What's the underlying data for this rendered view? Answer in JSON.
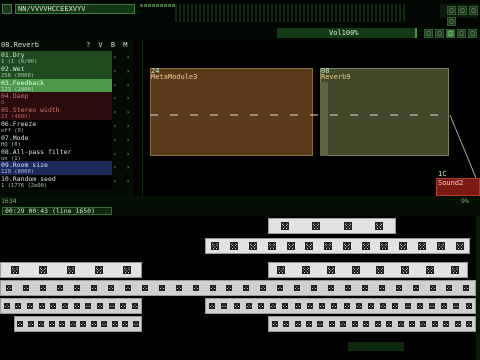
{
  "toolbar": {
    "song_name": "NN/VVVVHCCEEXVYV",
    "volume": "Vol100%",
    "buttons": [
      "◆",
      "□",
      "◉",
      "▸",
      "■"
    ],
    "right_buttons_top": [
      "□",
      "□",
      "□",
      "□"
    ],
    "right_buttons_mid": [
      "□",
      "□",
      "□",
      "□",
      "□"
    ]
  },
  "module_panel": {
    "title": "08.Reverb",
    "flags": "? V B M S",
    "controls": [
      {
        "label": "01.Dry",
        "value": "1 (1 (6/00)",
        "row_color": "#d4e8d4",
        "sub_color": "#a8c8a8",
        "bg": "#1f4a1f"
      },
      {
        "label": "02.Wet",
        "value": "256 (0000)",
        "row_color": "#d4e8d4",
        "sub_color": "#a8c8a8",
        "bg": "#1f4a1f"
      },
      {
        "label": "03.Feedback",
        "value": "123 (2000)",
        "row_color": "#f0f0f0",
        "sub_color": "#c8dac8",
        "bg": "#4a9a4a"
      },
      {
        "label": "04.Damp",
        "value": "0",
        "row_color": "#d47070",
        "sub_color": "#a86060",
        "bg": "#2a0c0c"
      },
      {
        "label": "05.Stereo width",
        "value": "23 (4000)",
        "row_color": "#e07070",
        "sub_color": "#b06060",
        "bg": "#2a0c0c"
      },
      {
        "label": "06.Freeze",
        "value": "off (0)",
        "row_color": "#d4e8d4",
        "sub_color": "#a8c8a8",
        "bg": "#000000"
      },
      {
        "label": "07.Mode",
        "value": "HQ (0)",
        "row_color": "#d4e8d4",
        "sub_color": "#a8c8a8",
        "bg": "#000000"
      },
      {
        "label": "08.All-pass filter",
        "value": "on (1)",
        "row_color": "#d4e8d4",
        "sub_color": "#a8c8a8",
        "bg": "#000000"
      },
      {
        "label": "09.Room size",
        "value": "120 (8000)",
        "row_color": "#e0e0ff",
        "sub_color": "#b8b8e0",
        "bg": "#1a2a5a"
      },
      {
        "label": "10.Random seed",
        "value": "1 (1776 (2e00)",
        "row_color": "#d4e8d4",
        "sub_color": "#a8c8a8",
        "bg": "#000000"
      }
    ],
    "arrows": "‹ ›"
  },
  "modules": {
    "meta": {
      "num": "24",
      "name": "MetaModule3"
    },
    "reverb": {
      "num": "08",
      "name": "Reverb9"
    },
    "sound": {
      "num": "1C",
      "name": "Sound2"
    }
  },
  "separator": {
    "left_text": "1634",
    "right_text": "9%"
  },
  "pattern": {
    "time": "00:29 00:43 (line 1650)"
  },
  "colors": {
    "accent": "#2f7f2f",
    "track_fill": "#e2e2e2",
    "meta_box": "#5b3a1c",
    "reverb_box": "#44482a",
    "sound_box": "#7a1a10"
  }
}
